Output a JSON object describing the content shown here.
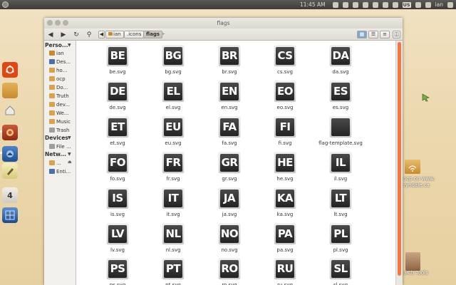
{
  "top_panel": {
    "clock": "11:45 AM",
    "keyboard_layout": "US",
    "user": "ian"
  },
  "launcher": {
    "items": [
      {
        "name": "ubuntu-logo-icon"
      },
      {
        "name": "home-folder-icon"
      },
      {
        "name": "workspace-switcher-icon"
      },
      {
        "name": "firefox-icon"
      },
      {
        "name": "thunderbird-icon"
      },
      {
        "name": "text-editor-icon"
      },
      {
        "name": "inkscape-icon"
      },
      {
        "name": "workspaces-icon"
      }
    ]
  },
  "window": {
    "title": "flags",
    "breadcrumbs": [
      "ian",
      ".icons",
      "flags"
    ],
    "active_crumb": 2
  },
  "sidebar": {
    "sections": [
      {
        "header": "Perso...",
        "items": [
          {
            "label": "ian",
            "icon": "home-icon"
          },
          {
            "label": "Des...",
            "icon": "desktop-icon"
          },
          {
            "label": "ho...",
            "icon": "folder-icon"
          },
          {
            "label": "ocp",
            "icon": "folder-icon"
          },
          {
            "label": "Do...",
            "icon": "documents-icon"
          },
          {
            "label": "Truth",
            "icon": "folder-icon"
          },
          {
            "label": "dev...",
            "icon": "folder-icon"
          },
          {
            "label": "We...",
            "icon": "folder-icon"
          },
          {
            "label": "Music",
            "icon": "music-icon"
          },
          {
            "label": "Trash",
            "icon": "trash-icon"
          }
        ]
      },
      {
        "header": "Devices",
        "items": [
          {
            "label": "File ...",
            "icon": "drive-icon"
          }
        ]
      },
      {
        "header": "Netw...",
        "items": [
          {
            "label": "...",
            "icon": "network-folder-icon"
          },
          {
            "label": "Enti...",
            "icon": "network-icon"
          }
        ]
      }
    ]
  },
  "files": [
    {
      "label": "be.svg",
      "code": "BE"
    },
    {
      "label": "bg.svg",
      "code": "BG"
    },
    {
      "label": "br.svg",
      "code": "BR"
    },
    {
      "label": "cs.svg",
      "code": "CS"
    },
    {
      "label": "da.svg",
      "code": "DA"
    },
    {
      "label": "de.svg",
      "code": "DE"
    },
    {
      "label": "el.svg",
      "code": "EL"
    },
    {
      "label": "en.svg",
      "code": "EN"
    },
    {
      "label": "eo.svg",
      "code": "EO"
    },
    {
      "label": "es.svg",
      "code": "ES"
    },
    {
      "label": "et.svg",
      "code": "ET"
    },
    {
      "label": "eu.svg",
      "code": "EU"
    },
    {
      "label": "fa.svg",
      "code": "FA"
    },
    {
      "label": "fi.svg",
      "code": "FI"
    },
    {
      "label": "flag-template.svg",
      "code": ""
    },
    {
      "label": "fo.svg",
      "code": "FO"
    },
    {
      "label": "fr.svg",
      "code": "FR"
    },
    {
      "label": "gr.svg",
      "code": "GR"
    },
    {
      "label": "he.svg",
      "code": "HE"
    },
    {
      "label": "il.svg",
      "code": "IL"
    },
    {
      "label": "is.svg",
      "code": "IS"
    },
    {
      "label": "it.svg",
      "code": "IT"
    },
    {
      "label": "ja.svg",
      "code": "JA"
    },
    {
      "label": "ka.svg",
      "code": "KA"
    },
    {
      "label": "lt.svg",
      "code": "LT"
    },
    {
      "label": "lv.svg",
      "code": "LV"
    },
    {
      "label": "nl.svg",
      "code": "NL"
    },
    {
      "label": "no.svg",
      "code": "NO"
    },
    {
      "label": "pa.svg",
      "code": "PA"
    },
    {
      "label": "pl.svg",
      "code": "PL"
    },
    {
      "label": "ps.svg",
      "code": "PS"
    },
    {
      "label": "pt.svg",
      "code": "PT"
    },
    {
      "label": "ro.svg",
      "code": "RO"
    },
    {
      "label": "ru.svg",
      "code": "RU"
    },
    {
      "label": "sl.svg",
      "code": "SL"
    }
  ],
  "desktop": {
    "items": [
      {
        "label": "ocp on www.",
        "label2": "ryndale.ca",
        "icon": "network-folder-icon"
      },
      {
        "label": "arch Tools",
        "icon": "book-icon"
      }
    ]
  },
  "colors": {
    "accent_scrollbar": "#f07746",
    "ubuntu_orange": "#dd4814",
    "selected_crumb": "#c3bfb6"
  }
}
